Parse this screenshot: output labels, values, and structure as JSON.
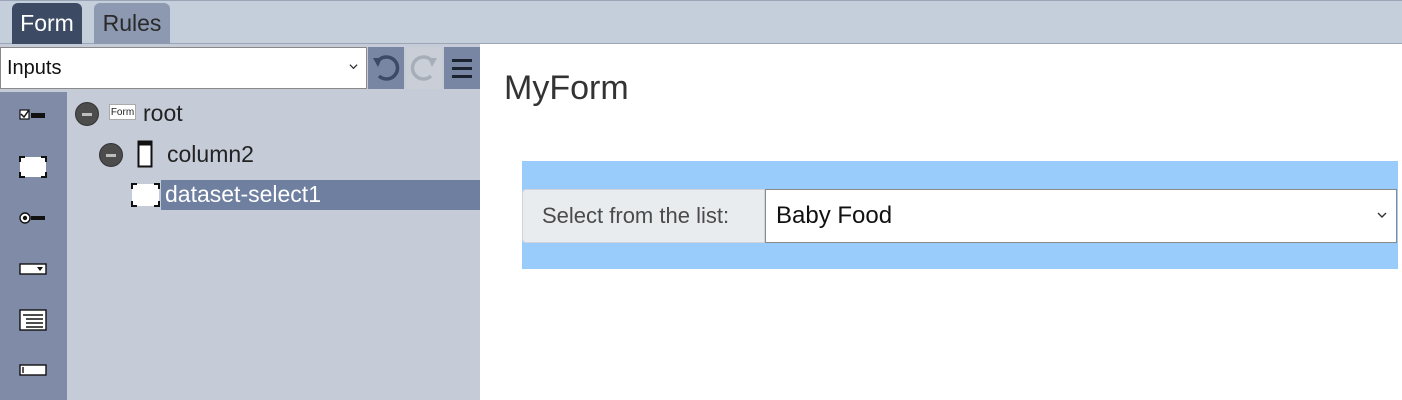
{
  "tabs": [
    {
      "label": "Form",
      "active": true
    },
    {
      "label": "Rules",
      "active": false
    }
  ],
  "toolbar": {
    "category_select_value": "Inputs",
    "undo_icon": "undo-icon",
    "redo_icon": "redo-icon",
    "menu_icon": "hamburger-menu-icon"
  },
  "palette": {
    "items": [
      "checkbox-input-icon",
      "select-input-icon",
      "radio-input-icon",
      "dropdown-input-icon",
      "list-input-icon",
      "text-input-icon"
    ]
  },
  "tree": {
    "root": {
      "badge": "Form",
      "label": "root"
    },
    "column": {
      "label": "column2"
    },
    "selected": {
      "label": "dataset-select1"
    }
  },
  "form": {
    "title": "MyForm",
    "field_label": "Select from the list:",
    "field_value": "Baby Food"
  },
  "colors": {
    "active_tab": "#3c4a63",
    "field_row_bg": "#99ccfa",
    "selected_node": "#6e7fa0"
  }
}
